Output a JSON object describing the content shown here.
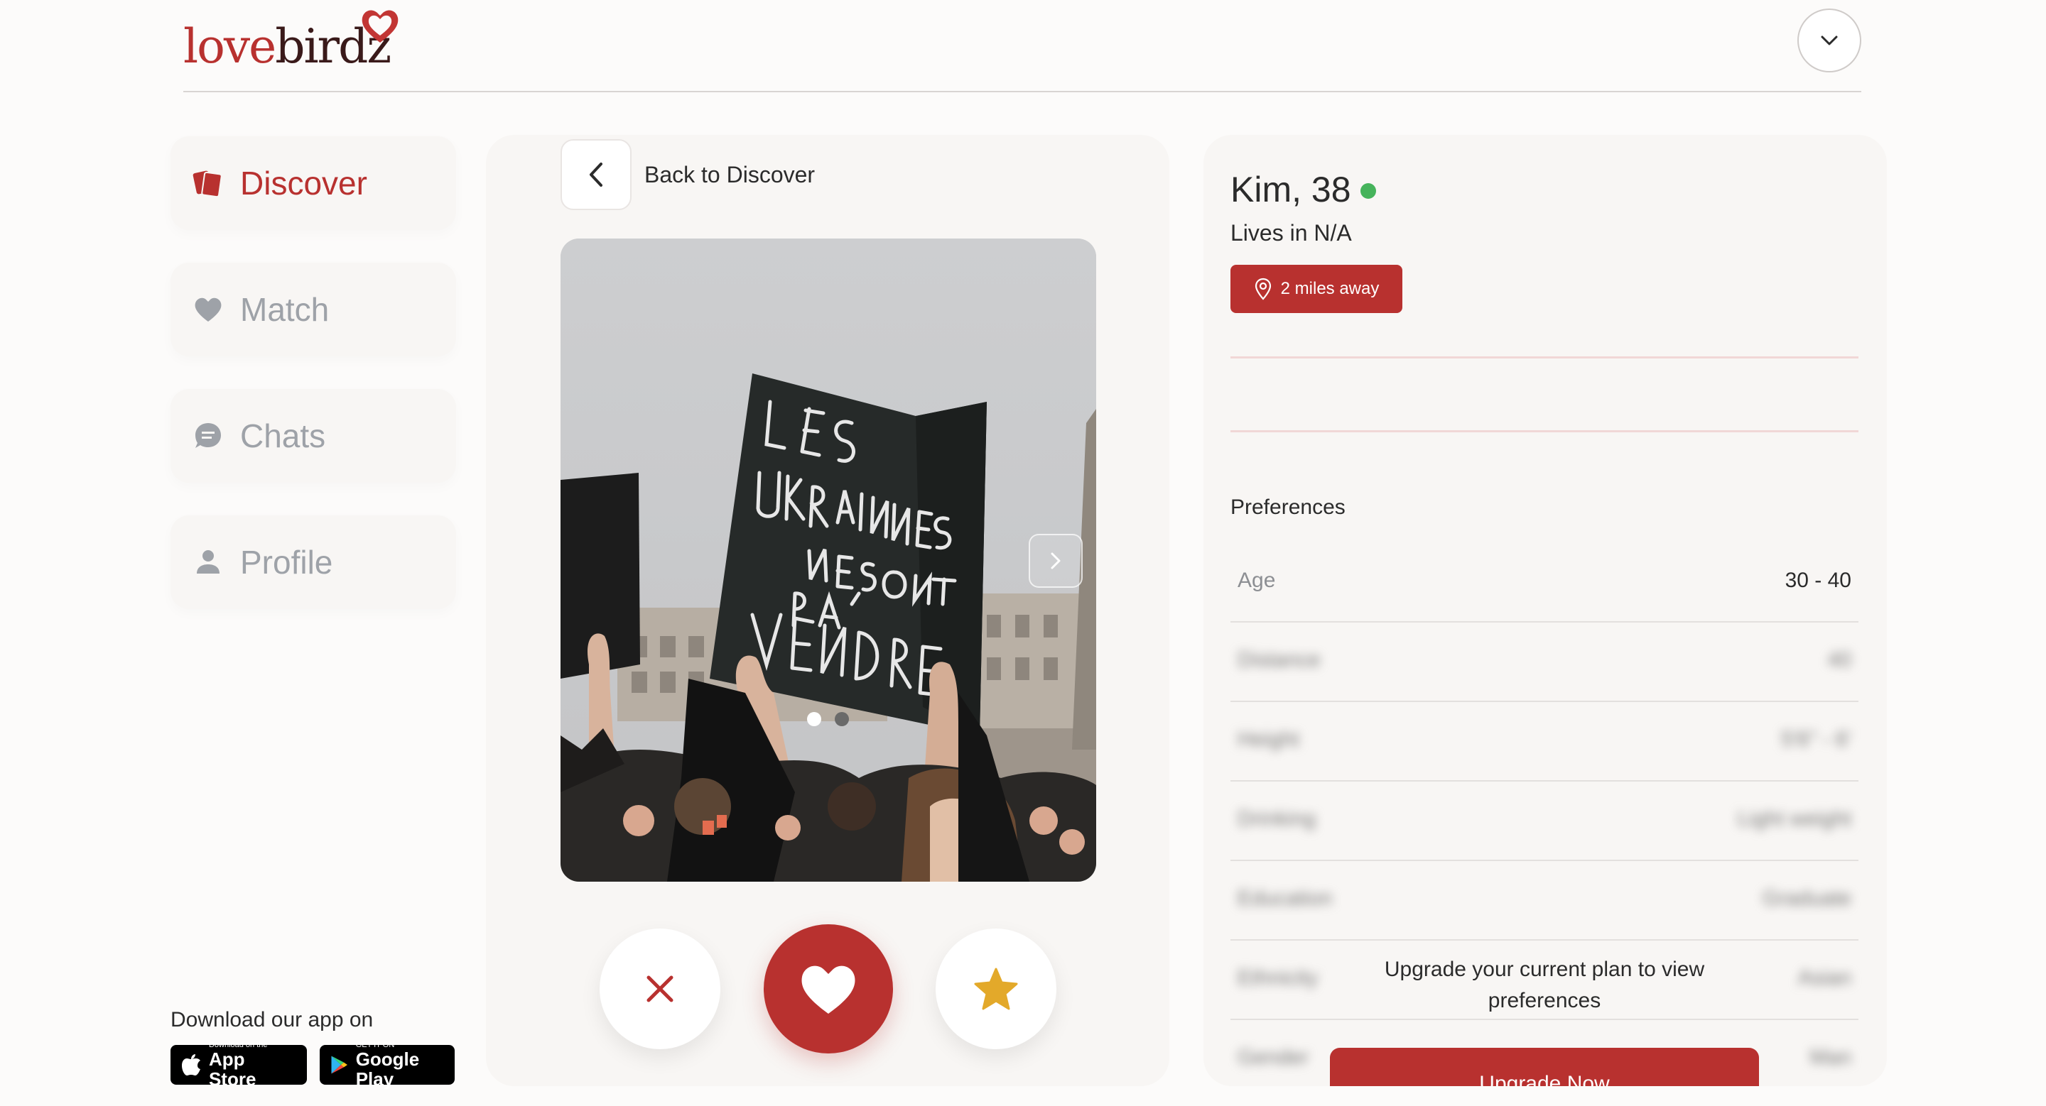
{
  "header": {
    "logo_love": "love",
    "logo_birdz": "birdz",
    "brand_color": "#b8312f"
  },
  "sidebar": {
    "items": [
      {
        "label": "Discover",
        "icon": "cards-icon",
        "active": true
      },
      {
        "label": "Match",
        "icon": "heart-icon",
        "active": false
      },
      {
        "label": "Chats",
        "icon": "chat-bubble-icon",
        "active": false
      },
      {
        "label": "Profile",
        "icon": "person-icon",
        "active": false
      }
    ],
    "download_label": "Download our app on",
    "app_store": {
      "small": "Download on the",
      "big": "App Store"
    },
    "google_play": {
      "small": "GET IT ON",
      "big": "Google Play"
    }
  },
  "center": {
    "back_label": "Back to Discover",
    "photo": {
      "sign_lines": [
        "LES",
        "UKRAINIENNES",
        "NE SONT",
        "PAS A",
        "VENDRE"
      ],
      "dots": 2,
      "active_dot": 1
    },
    "actions": {
      "pass": "close-icon",
      "like": "heart-icon",
      "super_like": "star-icon"
    }
  },
  "profile": {
    "name": "Kim, 38",
    "online": true,
    "lives": "Lives in N/A",
    "distance": "2 miles away",
    "preferences_title": "Preferences",
    "preferences": [
      {
        "key": "Age",
        "value": "30 - 40",
        "blurred": false
      },
      {
        "key": "Distance",
        "value": "40",
        "blurred": true
      },
      {
        "key": "Height",
        "value": "5'6\" - 6'",
        "blurred": true
      },
      {
        "key": "Drinking",
        "value": "Light weight",
        "blurred": true
      },
      {
        "key": "Education",
        "value": "Graduate",
        "blurred": true
      },
      {
        "key": "Ethnicity",
        "value": "Asian",
        "blurred": true
      },
      {
        "key": "Gender",
        "value": "Man",
        "blurred": true
      }
    ],
    "upgrade_text": "Upgrade your current plan to view preferences",
    "upgrade_button": "Upgrade Now"
  }
}
